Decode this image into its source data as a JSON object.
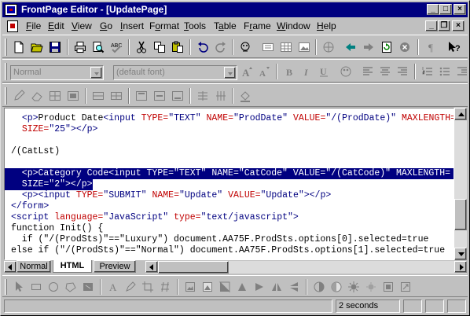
{
  "window": {
    "title": "FrontPage Editor - [UpdatePage]",
    "minimize": "_",
    "maximize": "□",
    "close": "×"
  },
  "menu": {
    "items": [
      {
        "label": "File",
        "underline": "F",
        "rest": "ile"
      },
      {
        "label": "Edit",
        "underline": "E",
        "rest": "dit"
      },
      {
        "label": "View",
        "underline": "V",
        "rest": "iew"
      },
      {
        "label": "Go",
        "underline": "G",
        "rest": "o"
      },
      {
        "label": "Insert",
        "underline": "I",
        "rest": "nsert"
      },
      {
        "label": "Format",
        "underline": "o",
        "pre": "F",
        "rest": "rmat"
      },
      {
        "label": "Tools",
        "underline": "T",
        "rest": "ools"
      },
      {
        "label": "Table",
        "underline": "a",
        "pre": "T",
        "rest": "ble"
      },
      {
        "label": "Frame",
        "underline": "r",
        "pre": "F",
        "rest": "ame"
      },
      {
        "label": "Window",
        "underline": "W",
        "rest": "indow"
      },
      {
        "label": "Help",
        "underline": "H",
        "rest": "elp"
      }
    ],
    "mdi_minimize": "_",
    "mdi_restore": "❐",
    "mdi_close": "×"
  },
  "format_toolbar": {
    "style_value": "Normal",
    "font_value": "(default font)"
  },
  "code_lines": [
    {
      "parts": [
        [
          "txt",
          "  "
        ],
        [
          "tag",
          "<p>"
        ],
        [
          "txt",
          "Product Date"
        ],
        [
          "tag",
          "<input "
        ],
        [
          "attr",
          "TYPE="
        ],
        [
          "aval",
          "\"TEXT\" "
        ],
        [
          "attr",
          "NAME="
        ],
        [
          "aval",
          "\"ProdDate\" "
        ],
        [
          "attr",
          "VALUE="
        ],
        [
          "aval",
          "\"/(ProdDate)\" "
        ],
        [
          "attr",
          "MAXLENGTH="
        ]
      ]
    },
    {
      "parts": [
        [
          "txt",
          "  "
        ],
        [
          "attr",
          "SIZE="
        ],
        [
          "aval",
          "\"25\""
        ],
        [
          "tag",
          "></p>"
        ]
      ]
    },
    {
      "parts": [
        [
          "txt",
          ""
        ]
      ]
    },
    {
      "parts": [
        [
          "txt",
          "/(CatLst)"
        ]
      ]
    },
    {
      "parts": [
        [
          "txt",
          ""
        ]
      ]
    },
    {
      "sel": true,
      "parts": [
        [
          "txt",
          "  <p>Category Code<input TYPE=\"TEXT\" NAME=\"CatCode\" VALUE=\"/(CatCode)\" MAXLENGTH="
        ]
      ]
    },
    {
      "sel": true,
      "partial": true,
      "parts": [
        [
          "txt",
          "  SIZE=\"2\"></p>"
        ]
      ]
    },
    {
      "parts": [
        [
          "txt",
          "  "
        ],
        [
          "tag",
          "<p><input "
        ],
        [
          "attr",
          "TYPE="
        ],
        [
          "aval",
          "\"SUBMIT\" "
        ],
        [
          "attr",
          "NAME="
        ],
        [
          "aval",
          "\"Update\" "
        ],
        [
          "attr",
          "VALUE="
        ],
        [
          "aval",
          "\"Update\""
        ],
        [
          "tag",
          "></p>"
        ]
      ]
    },
    {
      "parts": [
        [
          "tag",
          "</form>"
        ]
      ]
    },
    {
      "parts": [
        [
          "tag",
          "<script "
        ],
        [
          "attr",
          "language="
        ],
        [
          "aval",
          "\"JavaScript\" "
        ],
        [
          "attr",
          "type="
        ],
        [
          "aval",
          "\"text/javascript\""
        ],
        [
          "tag",
          ">"
        ]
      ]
    },
    {
      "parts": [
        [
          "txt",
          "function Init() {"
        ]
      ]
    },
    {
      "parts": [
        [
          "txt",
          "  if (\"/(ProdSts)\"==\"Luxury\") document.AA75F.ProdSts.options[0].selected=true"
        ]
      ]
    },
    {
      "parts": [
        [
          "txt",
          "else if (\"/(ProdSts)\"==\"Normal\") document.AA75F.ProdSts.options[1].selected=true"
        ]
      ]
    }
  ],
  "tabs": [
    {
      "label": "Normal"
    },
    {
      "label": "HTML"
    },
    {
      "label": "Preview"
    }
  ],
  "status": {
    "time": "2 seconds"
  }
}
